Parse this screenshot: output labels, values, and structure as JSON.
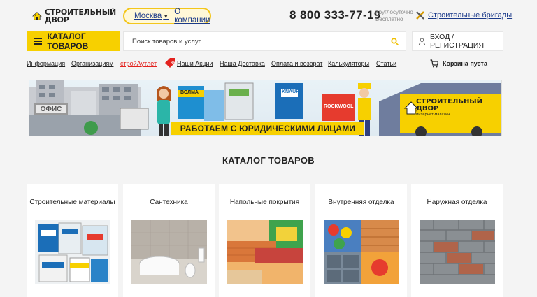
{
  "header": {
    "logo_line1": "СТРОИТЕЛЬНЫЙ",
    "logo_line2": "ДВОР",
    "city": "Москва",
    "about_link": "О компании",
    "phone": "8 800 333-77-19",
    "phone_note_line1": "Круглосуточно",
    "phone_note_line2": "Бесплатно",
    "brigades_link": "Строительные бригады"
  },
  "toolbar": {
    "catalog_button": "КАТАЛОГ ТОВАРОВ",
    "search_placeholder": "Поиск товаров и услуг",
    "login_button": "ВХОД / РЕГИСТРАЦИЯ"
  },
  "nav": {
    "items": [
      {
        "label": "Информация"
      },
      {
        "label": "Организациям"
      },
      {
        "label": "стройАутлет"
      },
      {
        "label": "Наши Акции"
      },
      {
        "label": "Наша Доставка"
      },
      {
        "label": "Оплата и возврат"
      },
      {
        "label": "Калькуляторы"
      },
      {
        "label": "Статьи"
      }
    ],
    "cart": "Корзина пуста"
  },
  "banner": {
    "headline": "РАБОТАЕМ С ЮРИДИЧЕСКИМИ ЛИЦАМИ",
    "office_sign": "ОФИС",
    "truck_logo_line1": "СТРОИТЕЛЬНЫЙ",
    "truck_logo_line2": "ДВОР",
    "truck_logo_sub": "интернет-магазин",
    "bag1": "ВОЛМА",
    "bag2": "KNAUF",
    "bag3": "ROCKWOOL"
  },
  "catalog": {
    "title": "КАТАЛОГ ТОВАРОВ",
    "categories": [
      {
        "label": "Строительные материалы"
      },
      {
        "label": "Сантехника"
      },
      {
        "label": "Напольные покрытия"
      },
      {
        "label": "Внутренняя отделка"
      },
      {
        "label": "Наружная отделка"
      }
    ]
  },
  "colors": {
    "accent": "#f7d000",
    "link": "#1b3a8a",
    "promo": "#e3231f",
    "background": "#f4f4f4"
  }
}
